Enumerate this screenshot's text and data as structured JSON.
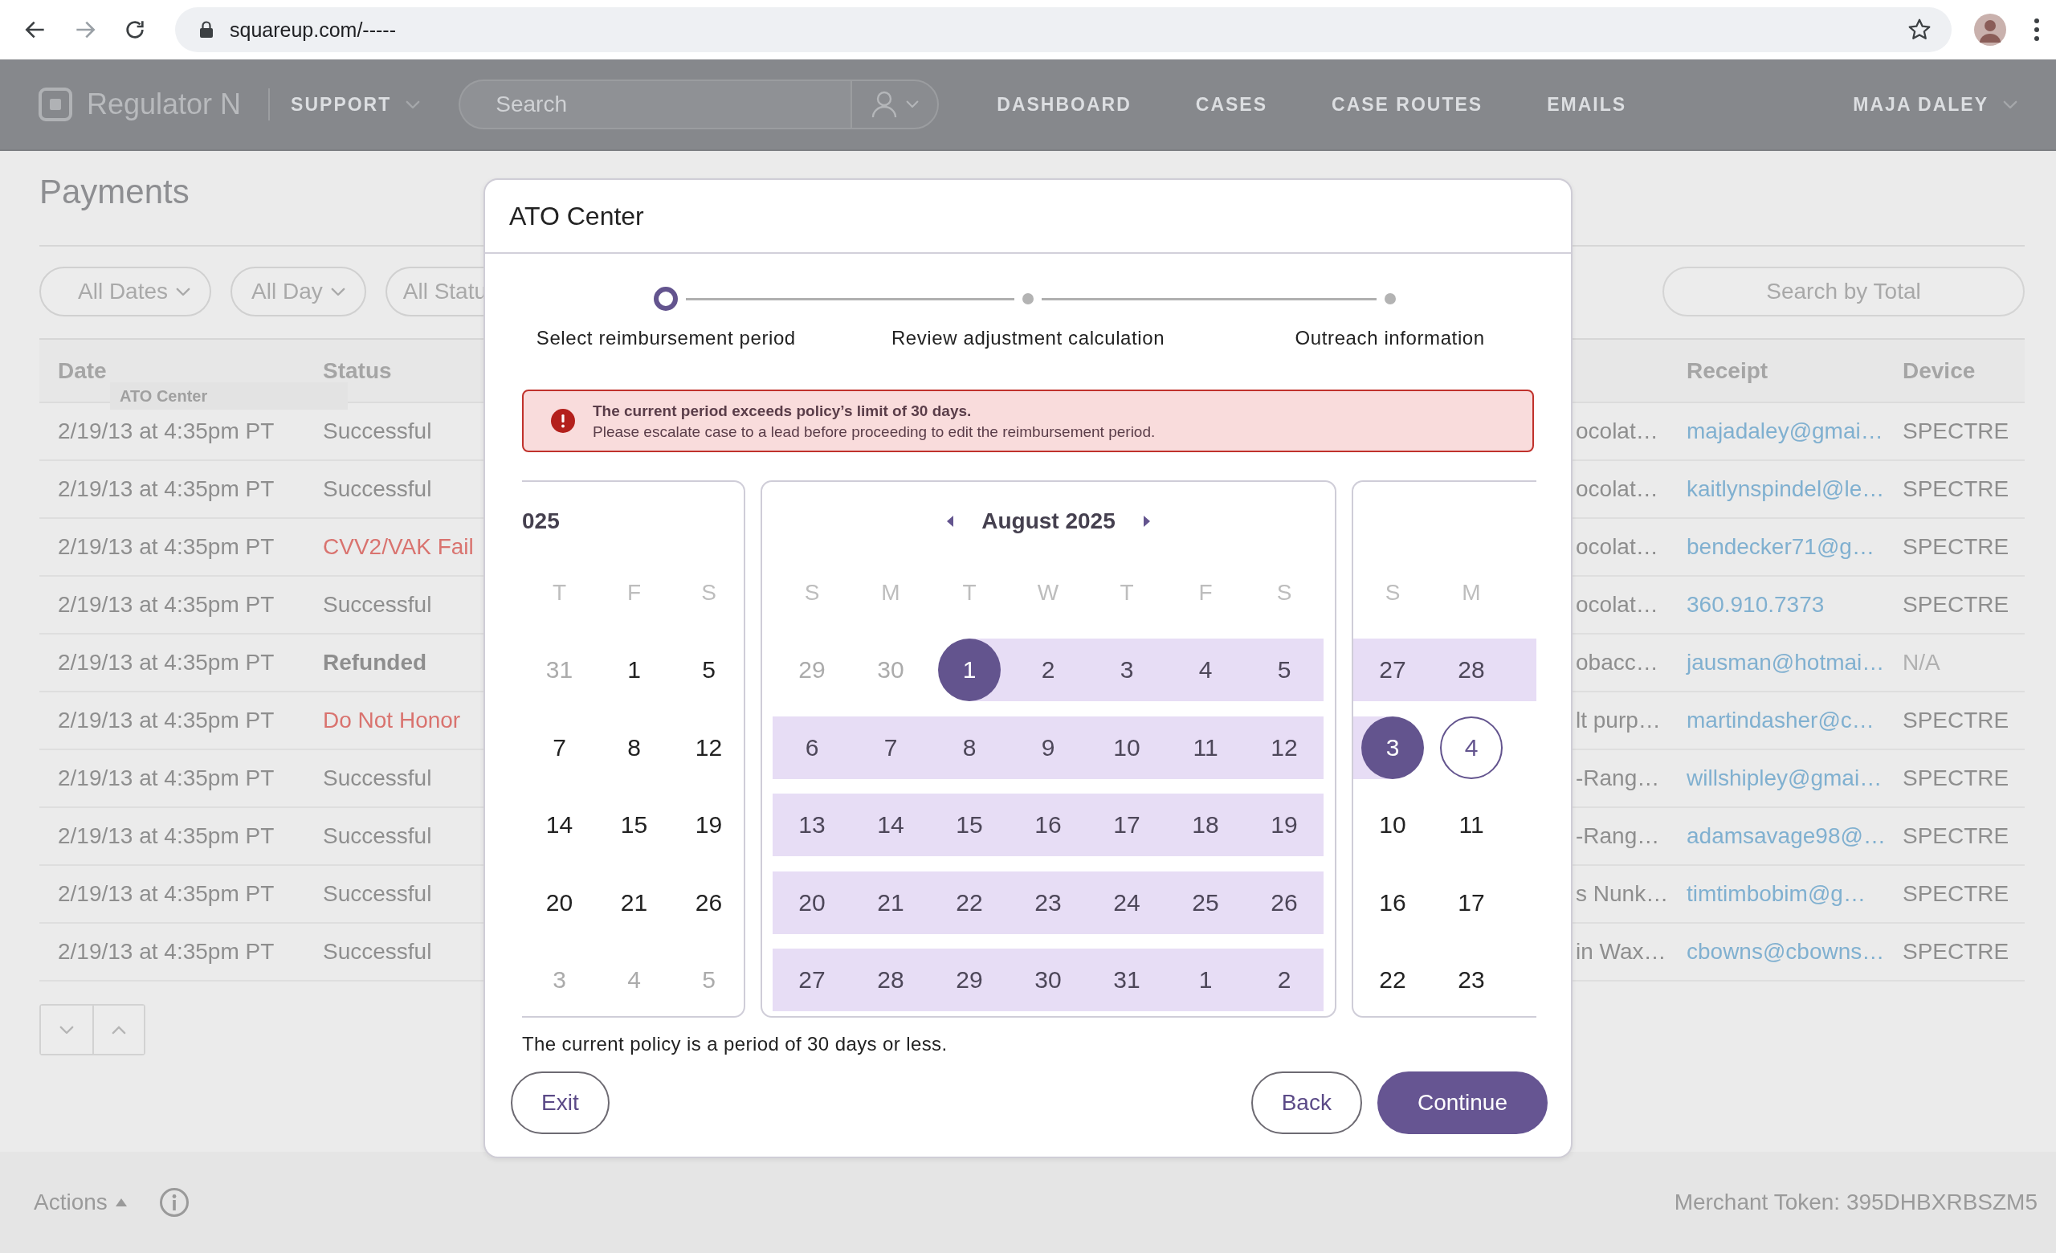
{
  "browser": {
    "url": "squareup.com/-----"
  },
  "app_header": {
    "product": "Regulator N",
    "menu": "SUPPORT",
    "search": {
      "placeholder": "Search"
    },
    "nav": [
      {
        "label": "DASHBOARD"
      },
      {
        "label": "CASES"
      },
      {
        "label": "CASE ROUTES"
      },
      {
        "label": "EMAILS"
      }
    ],
    "user": "MAJA DALEY"
  },
  "page": {
    "title": "Payments",
    "filters": [
      {
        "label": "All Dates",
        "caret": true
      },
      {
        "label": "All Day",
        "caret": true
      },
      {
        "label": "All Statu",
        "caret": false
      }
    ],
    "total_search": {
      "placeholder": "Search by Total"
    },
    "table": {
      "columns": [
        {
          "label": "Date"
        },
        {
          "label": "Status"
        },
        {
          "label": "Receipt"
        },
        {
          "label": "Device"
        }
      ],
      "tooltip": "ATO Center",
      "rows": [
        {
          "date": "2/19/13 at 4:35pm PT",
          "status": {
            "text": "Successful",
            "kind": "success"
          },
          "description": "ocolat…",
          "receipt": "majadaley@gmai…",
          "device": "SPECTRE",
          "device_muted": false
        },
        {
          "date": "2/19/13 at 4:35pm PT",
          "status": {
            "text": "Successful",
            "kind": "success"
          },
          "description": "ocolat…",
          "receipt": "kaitlynspindel@le…",
          "device": "SPECTRE",
          "device_muted": false
        },
        {
          "date": "2/19/13 at 4:35pm PT",
          "status": {
            "text": "CVV2/VAK Fail",
            "kind": "failure"
          },
          "description": "ocolat…",
          "receipt": "bendecker71@g…",
          "device": "SPECTRE",
          "device_muted": false
        },
        {
          "date": "2/19/13 at 4:35pm PT",
          "status": {
            "text": "Successful",
            "kind": "success"
          },
          "description": "ocolat…",
          "receipt": "360.910.7373",
          "device": "SPECTRE",
          "device_muted": false
        },
        {
          "date": "2/19/13 at 4:35pm PT",
          "status": {
            "text": "Refunded",
            "kind": "refunded"
          },
          "description": "obacc…",
          "receipt": "jausman@hotmai…",
          "device": "N/A",
          "device_muted": true
        },
        {
          "date": "2/19/13 at 4:35pm PT",
          "status": {
            "text": "Do Not Honor",
            "kind": "failure"
          },
          "description": "lt purp…",
          "receipt": "martindasher@c…",
          "device": "SPECTRE",
          "device_muted": false
        },
        {
          "date": "2/19/13 at 4:35pm PT",
          "status": {
            "text": "Successful",
            "kind": "success"
          },
          "description": "-Rang…",
          "receipt": "willshipley@gmai…",
          "device": "SPECTRE",
          "device_muted": false
        },
        {
          "date": "2/19/13 at 4:35pm PT",
          "status": {
            "text": "Successful",
            "kind": "success"
          },
          "description": "-Rang…",
          "receipt": "adamsavage98@…",
          "device": "SPECTRE",
          "device_muted": false
        },
        {
          "date": "2/19/13 at 4:35pm PT",
          "status": {
            "text": "Successful",
            "kind": "success"
          },
          "description": "s Nunk…",
          "receipt": "timtimbobim@g…",
          "device": "SPECTRE",
          "device_muted": false
        },
        {
          "date": "2/19/13 at 4:35pm PT",
          "status": {
            "text": "Successful",
            "kind": "success"
          },
          "description": "in Wax…",
          "receipt": "cbowns@cbowns…",
          "device": "SPECTRE",
          "device_muted": false
        }
      ]
    }
  },
  "footer": {
    "actions": "Actions",
    "merchant_token": "Merchant Token: 395DHBXRBSZM5"
  },
  "modal": {
    "title": "ATO Center",
    "steps": [
      {
        "label": "Select reimbursement period",
        "selected": true
      },
      {
        "label": "Review adjustment calculation",
        "selected": false
      },
      {
        "label": "Outreach information",
        "selected": false
      }
    ],
    "alert": {
      "title": "The current period exceeds policy’s limit of 30 days.",
      "message": "Please escalate case to a lead before proceeding to edit the reimbursement period."
    },
    "calendars": [
      {
        "heading": "025",
        "navigation": false,
        "clipped_left": true,
        "clipped_right": false,
        "weekdays": [
          "T",
          "F",
          "S"
        ],
        "weeks": [
          [
            {
              "day": "31",
              "kind": "muted"
            },
            {
              "day": "1",
              "kind": "normal"
            },
            {
              "day": "5",
              "kind": "normal"
            }
          ],
          [
            {
              "day": "7",
              "kind": "normal"
            },
            {
              "day": "8",
              "kind": "normal"
            },
            {
              "day": "12",
              "kind": "normal"
            }
          ],
          [
            {
              "day": "14",
              "kind": "normal"
            },
            {
              "day": "15",
              "kind": "normal"
            },
            {
              "day": "19",
              "kind": "normal"
            }
          ],
          [
            {
              "day": "20",
              "kind": "normal"
            },
            {
              "day": "21",
              "kind": "normal"
            },
            {
              "day": "26",
              "kind": "normal"
            }
          ],
          [
            {
              "day": "3",
              "kind": "muted"
            },
            {
              "day": "4",
              "kind": "muted"
            },
            {
              "day": "5",
              "kind": "muted"
            }
          ]
        ]
      },
      {
        "heading": "August 2025",
        "navigation": true,
        "clipped_left": false,
        "clipped_right": false,
        "weekdays": [
          "S",
          "M",
          "T",
          "W",
          "T",
          "F",
          "S"
        ],
        "weeks": [
          [
            {
              "day": "29",
              "kind": "muted"
            },
            {
              "day": "30",
              "kind": "muted"
            },
            {
              "day": "1",
              "kind": "range_end"
            },
            {
              "day": "2",
              "kind": "range"
            },
            {
              "day": "3",
              "kind": "range"
            },
            {
              "day": "4",
              "kind": "range"
            },
            {
              "day": "5",
              "kind": "range"
            }
          ],
          [
            {
              "day": "6",
              "kind": "range"
            },
            {
              "day": "7",
              "kind": "range"
            },
            {
              "day": "8",
              "kind": "range"
            },
            {
              "day": "9",
              "kind": "range"
            },
            {
              "day": "10",
              "kind": "range"
            },
            {
              "day": "11",
              "kind": "range"
            },
            {
              "day": "12",
              "kind": "range"
            }
          ],
          [
            {
              "day": "13",
              "kind": "range"
            },
            {
              "day": "14",
              "kind": "range"
            },
            {
              "day": "15",
              "kind": "range"
            },
            {
              "day": "16",
              "kind": "range"
            },
            {
              "day": "17",
              "kind": "range"
            },
            {
              "day": "18",
              "kind": "range"
            },
            {
              "day": "19",
              "kind": "range"
            }
          ],
          [
            {
              "day": "20",
              "kind": "range"
            },
            {
              "day": "21",
              "kind": "range"
            },
            {
              "day": "22",
              "kind": "range"
            },
            {
              "day": "23",
              "kind": "range"
            },
            {
              "day": "24",
              "kind": "range"
            },
            {
              "day": "25",
              "kind": "range"
            },
            {
              "day": "26",
              "kind": "range"
            }
          ],
          [
            {
              "day": "27",
              "kind": "range"
            },
            {
              "day": "28",
              "kind": "range"
            },
            {
              "day": "29",
              "kind": "range"
            },
            {
              "day": "30",
              "kind": "range"
            },
            {
              "day": "31",
              "kind": "range"
            },
            {
              "day": "1",
              "kind": "range"
            },
            {
              "day": "2",
              "kind": "range"
            }
          ]
        ]
      },
      {
        "navigation": false,
        "clipped_left": false,
        "clipped_right": true,
        "weekdays": [
          "S",
          "M"
        ],
        "weeks": [
          [
            {
              "day": "27",
              "kind": "range"
            },
            {
              "day": "28",
              "kind": "range"
            }
          ],
          [
            {
              "day": "3",
              "kind": "range_end"
            },
            {
              "day": "4",
              "kind": "hover"
            }
          ],
          [
            {
              "day": "10",
              "kind": "normal"
            },
            {
              "day": "11",
              "kind": "normal"
            }
          ],
          [
            {
              "day": "16",
              "kind": "normal"
            },
            {
              "day": "17",
              "kind": "normal"
            }
          ],
          [
            {
              "day": "22",
              "kind": "normal"
            },
            {
              "day": "23",
              "kind": "normal"
            }
          ]
        ]
      }
    ],
    "note": "The current policy is a period of 30 days or less.",
    "buttons": [
      {
        "label": "Exit",
        "kind": "secondary"
      },
      {
        "label": "Back",
        "kind": "secondary"
      },
      {
        "label": "Continue",
        "kind": "primary"
      }
    ]
  }
}
